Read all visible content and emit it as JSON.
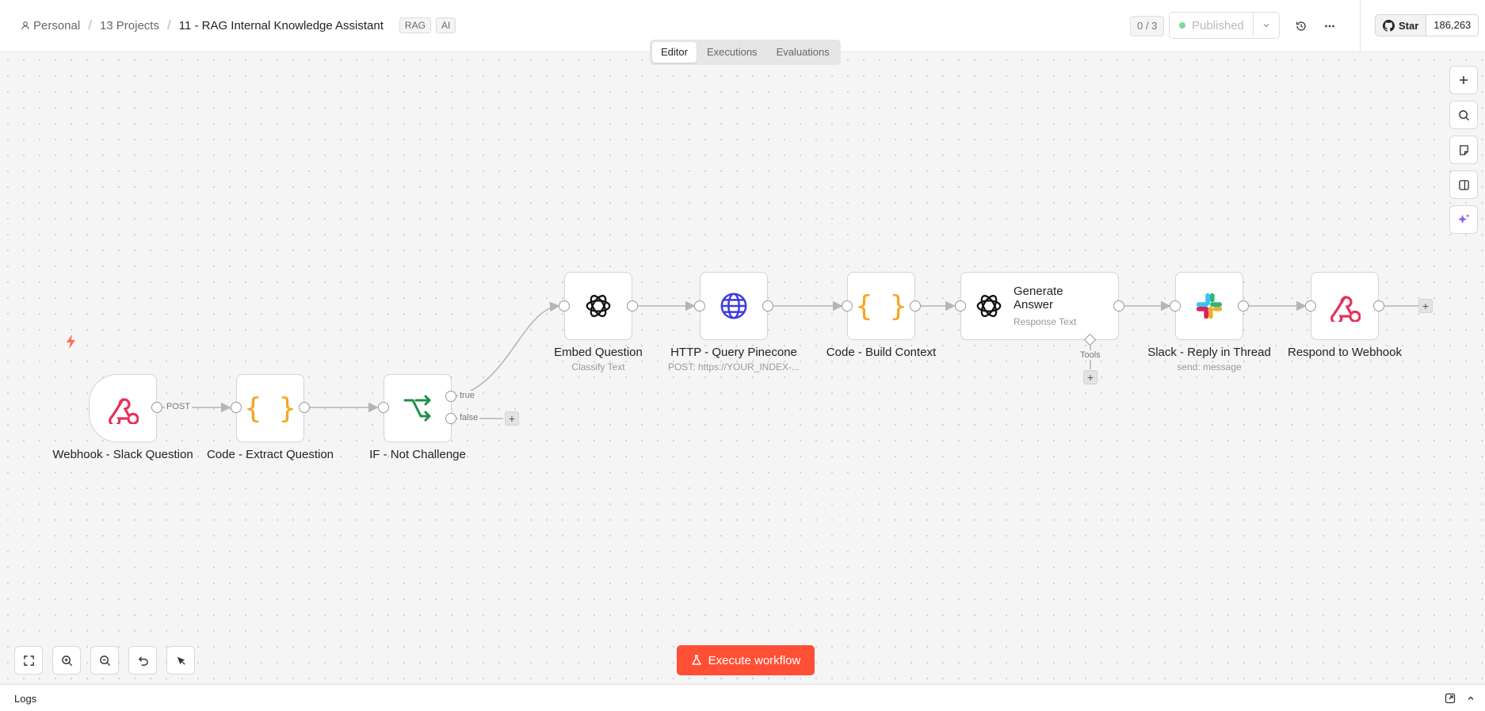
{
  "header": {
    "breadcrumb": {
      "personal": "Personal",
      "projects": "13 Projects",
      "workflow": "11 - RAG Internal Knowledge Assistant"
    },
    "tags": [
      "RAG",
      "AI"
    ],
    "counter": "0 / 3",
    "publish_label": "Published",
    "github": {
      "star_label": "Star",
      "count": "186,263"
    }
  },
  "tabs": {
    "editor": "Editor",
    "executions": "Executions",
    "evaluations": "Evaluations"
  },
  "nodes": {
    "webhook": {
      "label": "Webhook - Slack Question"
    },
    "extract": {
      "label": "Code - Extract Question"
    },
    "if": {
      "label": "IF - Not Challenge"
    },
    "embed": {
      "label": "Embed Question",
      "sub": "Classify Text"
    },
    "http": {
      "label": "HTTP - Query Pinecone",
      "sub": "POST: https://YOUR_INDEX-..."
    },
    "build": {
      "label": "Code - Build Context"
    },
    "generate": {
      "label": "Generate Answer",
      "sub": "Response Text",
      "tools": "Tools"
    },
    "slack": {
      "label": "Slack - Reply in Thread",
      "sub": "send: message"
    },
    "respond": {
      "label": "Respond to Webhook"
    }
  },
  "edge_labels": {
    "post": "POST",
    "true": "true",
    "false": "false"
  },
  "execute_label": "Execute workflow",
  "logs_label": "Logs",
  "colors": {
    "accent": "#ff4f35",
    "webhook": "#e8305a",
    "code": "#f5a623",
    "if": "#1f8f4a",
    "http": "#3b3ae0"
  },
  "icons": [
    "person-icon",
    "history-icon",
    "more-icon",
    "github-icon",
    "plus-icon",
    "search-icon",
    "sticky-note-icon",
    "panel-icon",
    "sparkle-icon",
    "fit-view-icon",
    "zoom-in-icon",
    "zoom-out-icon",
    "undo-icon",
    "tidy-icon",
    "flask-icon",
    "lightning-icon",
    "openai-icon",
    "globe-icon",
    "slack-icon",
    "webhook-icon",
    "code-icon",
    "branch-icon"
  ]
}
